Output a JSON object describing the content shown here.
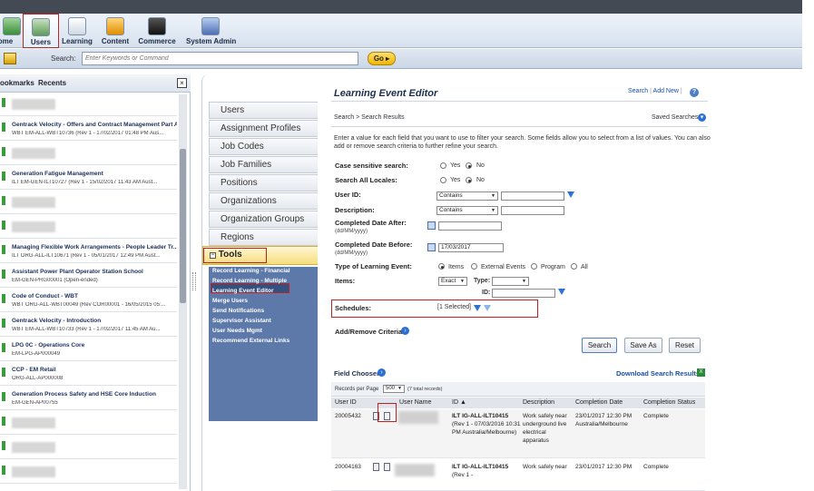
{
  "nav": {
    "items": [
      {
        "label": "Home",
        "icon": "home-icon",
        "active": false
      },
      {
        "label": "Users",
        "icon": "users-icon",
        "active": true
      },
      {
        "label": "Learning",
        "icon": "learning-icon",
        "active": false
      },
      {
        "label": "Content",
        "icon": "content-icon",
        "active": false
      },
      {
        "label": "Commerce",
        "icon": "commerce-icon",
        "active": false
      },
      {
        "label": "System Admin",
        "icon": "system-admin-icon",
        "active": false
      }
    ]
  },
  "search": {
    "label": "Search:",
    "placeholder": "Enter Keywords or Command",
    "go_label": "Go"
  },
  "left_panel": {
    "tab_bookmarks": "ookmarks",
    "tab_recents": "Recents",
    "close_label": "×",
    "recents": [
      {
        "title": "",
        "sub": ""
      },
      {
        "title": "Gentrack Velocity - Offers and Contract Management Part A",
        "sub": "WBT EM-ALL-WBT10736 (Rev 1 - 17/02/2017 01:48 PM Aus..."
      },
      {
        "title": "",
        "sub": ""
      },
      {
        "title": "Generation Fatigue Management",
        "sub": "ILT EM-GEN-ILT10727 (Rev 1 - 15/02/2017 11:43 AM Aust..."
      },
      {
        "title": "",
        "sub": ""
      },
      {
        "title": "",
        "sub": ""
      },
      {
        "title": "Managing Flexible Work Arrangements - People Leader Tr...",
        "sub": "ILT ORG-ALL-ILT10671 (Rev 1 - 05/01/2017 12:49 PM Aust..."
      },
      {
        "title": "Assistant Power Plant Operator Station School",
        "sub": "EM-GEN-PRG00001 (Open-ended)"
      },
      {
        "title": "Code of Conduct - WBT",
        "sub": "WBT ORG-ALL-WBT00049 (Rev COR00001 - 16/05/2015 05:..."
      },
      {
        "title": "Gentrack Velocity - Introduction",
        "sub": "WBT EM-ALL-WBT10733 (Rev 1 - 17/02/2017 11:45 AM Au..."
      },
      {
        "title": "LPG 0C - Operations Core",
        "sub": "EM-LPG-AP000049"
      },
      {
        "title": "CCP - EM Retail",
        "sub": "ORG-ALL-AP000008"
      },
      {
        "title": "Generation Process Safety and HSE Core Induction",
        "sub": "EM-GEN-AP00755"
      },
      {
        "title": "",
        "sub": ""
      },
      {
        "title": "",
        "sub": ""
      },
      {
        "title": "",
        "sub": ""
      }
    ]
  },
  "menu": {
    "items": [
      "Users",
      "Assignment Profiles",
      "Job Codes",
      "Job Families",
      "Positions",
      "Organizations",
      "Organization Groups",
      "Regions"
    ],
    "tools_label": "Tools",
    "tools_sub": [
      "Record Learning - Financial",
      "Record Learning - Multiple",
      "Learning Event Editor",
      "Merge Users",
      "Send Notifications",
      "Supervisor Assistant",
      "User Needs Mgmt",
      "Recommend External Links"
    ]
  },
  "main": {
    "title": "Learning Event Editor",
    "link_search": "Search",
    "link_add_new": "Add New",
    "breadcrumb": "Search > Search Results",
    "saved_searches": "Saved Searches",
    "intro": "Enter a value for each field that you want to use to filter your search. Some fields allow you to select from a list of values. You can also add or remove search criteria to further refine your search.",
    "case_sensitive_label": "Case sensitive search:",
    "all_locales_label": "Search All Locales:",
    "yes": "Yes",
    "no": "No",
    "user_id_label": "User ID:",
    "description_label": "Description:",
    "contains": "Contains",
    "completed_after_label": "Completed Date After:",
    "completed_before_label": "Completed Date Before:",
    "date_hint": "(dd/MM/yyyy)",
    "completed_before_value": "17/03/2017",
    "type_label": "Type of Learning Event:",
    "type_options": [
      "Items",
      "External Events",
      "Program",
      "All"
    ],
    "items_label": "Items:",
    "items_exact": "Exact",
    "type_small_label": "Type:",
    "id_small_label": "ID:",
    "schedules_label": "Schedules:",
    "schedules_value": "[1 Selected]",
    "add_remove": "Add/Remove Criteria",
    "btn_search": "Search",
    "btn_save_as": "Save As",
    "btn_reset": "Reset",
    "field_chooser": "Field Chooser",
    "download": "Download Search Results",
    "records_per_page_label": "Records per Page",
    "records_per_page_value": "500",
    "total_records": "(7 total records)",
    "headers": [
      "User ID",
      "User Name",
      "ID ▲",
      "Description",
      "Completion Date",
      "Completion Status"
    ],
    "rows": [
      {
        "user_id": "20005432",
        "id_bold": "ILT IG-ALL-ILT10415",
        "id_rest": "(Rev 1 - 07/03/2016 10:31 PM Australia/Melbourne)",
        "description": "Work safely near underground live electrical apparatus",
        "date": "23/01/2017 12:30 PM Australia/Melbourne",
        "status": "Complete"
      },
      {
        "user_id": "20004163",
        "id_bold": "ILT IG-ALL-ILT10415",
        "id_rest": "(Rev 1 -",
        "description": "Work safely near",
        "date": "23/01/2017 12:30 PM",
        "status": "Complete"
      }
    ]
  }
}
